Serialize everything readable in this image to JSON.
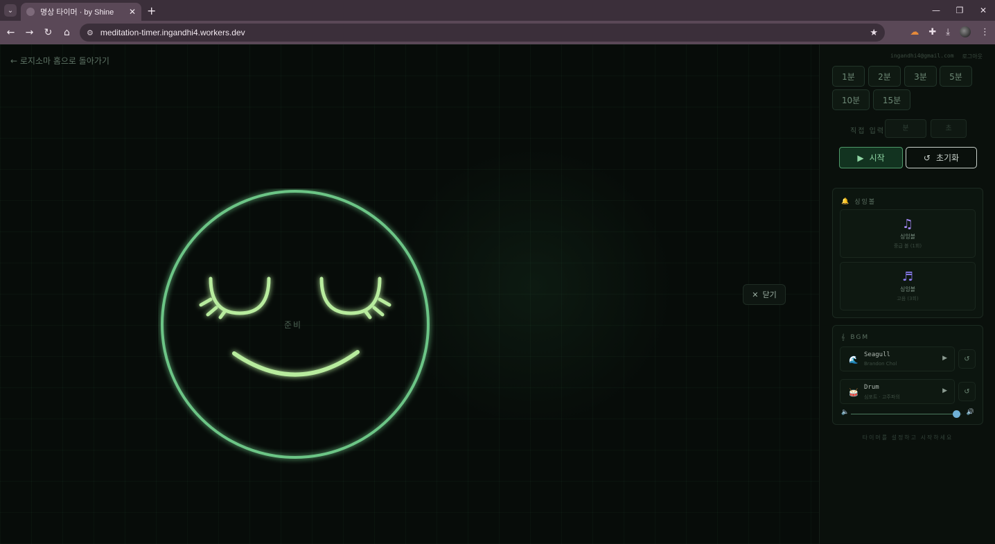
{
  "browser": {
    "tab_title": "명상 타이머 · by Shine",
    "url": "meditation-timer.ingandhi4.workers.dev"
  },
  "page": {
    "back_link": "← 로지소마 홈으로 돌아가기",
    "ready_label": "준비",
    "close_label": "닫기",
    "face_color": "#6cc586",
    "feature_color": "#b8ec9e"
  },
  "side": {
    "email": "ingandhi4@gmail.com",
    "logout": "로그아웃",
    "presets": [
      "1분",
      "2분",
      "3분",
      "5분",
      "10분",
      "15분"
    ],
    "direct_label": "직접 입력",
    "minute_placeholder": "분",
    "second_placeholder": "초",
    "start_label": "시작",
    "reset_label": "초기화",
    "singing_bowl": {
      "title": "싱잉볼",
      "items": [
        {
          "name": "싱잉볼",
          "sub": "중급 볼 (1회)",
          "icon": "music-note-icon"
        },
        {
          "name": "싱잉볼",
          "sub": "고음 (3회)",
          "icon": "music-notes-icon"
        }
      ]
    },
    "bgm": {
      "title": "BGM",
      "tracks": [
        {
          "title": "Seagull",
          "artist": "Brandon Chol",
          "icon": "wave-icon"
        },
        {
          "title": "Drum",
          "artist": "심포트 · 고주파의",
          "icon": "drum-icon"
        }
      ],
      "volume": 0.95
    },
    "hint": "타이머를 설정하고 시작하세요"
  }
}
